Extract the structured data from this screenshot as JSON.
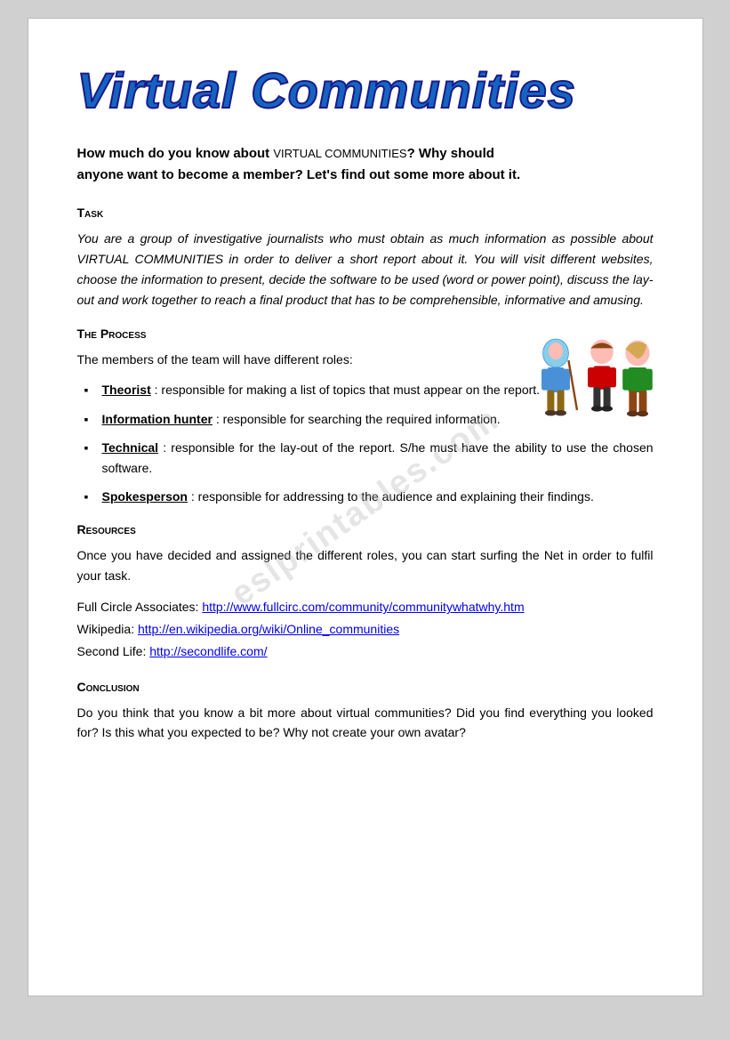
{
  "page": {
    "watermark": "eslprintables.com"
  },
  "title": {
    "text": "Virtual Communities"
  },
  "intro": {
    "line1_bold": "How much do you know ",
    "line1_smallcaps": "about",
    "line1_bold2": " VIRTUAL COMMUNITIES",
    "line1_bold3": "? Why ",
    "line1_bold4": "should",
    "line2": "anyone want to become a member? Let's find out some more about it."
  },
  "sections": {
    "task": {
      "heading": "Task",
      "body": "You are a group of investigative journalists who must obtain as much information as possible about VIRTUAL COMMUNITIES in order to deliver a short report about it. You will visit different websites, choose the information to present, decide the software to be used (word or power point), discuss the lay-out and work together to reach a final product that has to be comprehensible, informative and amusing."
    },
    "process": {
      "heading": "The Process",
      "intro": "The members of the team will have different roles:",
      "roles": [
        {
          "term": "Theorist",
          "description": ": responsible for making a list of topics that must appear on the report."
        },
        {
          "term": "Information hunter",
          "description": ": responsible for searching the required information."
        },
        {
          "term": "Technical",
          "description": ": responsible for the lay-out of the report. S/he must have the ability to use the chosen software."
        },
        {
          "term": "Spokesperson",
          "description": ": responsible for addressing to the audience and explaining their findings."
        }
      ]
    },
    "resources": {
      "heading": "Resources",
      "body": "Once you have decided and assigned the different roles, you can start surfing the Net in order to fulfil your task.",
      "links": [
        {
          "label": "Full Circle Associates: ",
          "url": "http://www.fullcirc.com/community/communitywhatwhy.htm",
          "url_text": "http://www.fullcirc.com/community/communitywhatwhy.htm"
        },
        {
          "label": "Wikipedia: ",
          "url": "http://en.wikipedia.org/wiki/Online_communities",
          "url_text": "http://en.wikipedia.org/wiki/Online_communities"
        },
        {
          "label": "Second Life: ",
          "url": "http://secondlife.com/",
          "url_text": "http://secondlife.com/"
        }
      ]
    },
    "conclusion": {
      "heading": "Conclusion",
      "body": "Do you think that you know a bit more about virtual communities? Did you find everything you looked for? Is this what you expected to be? Why not create your own avatar?"
    }
  }
}
